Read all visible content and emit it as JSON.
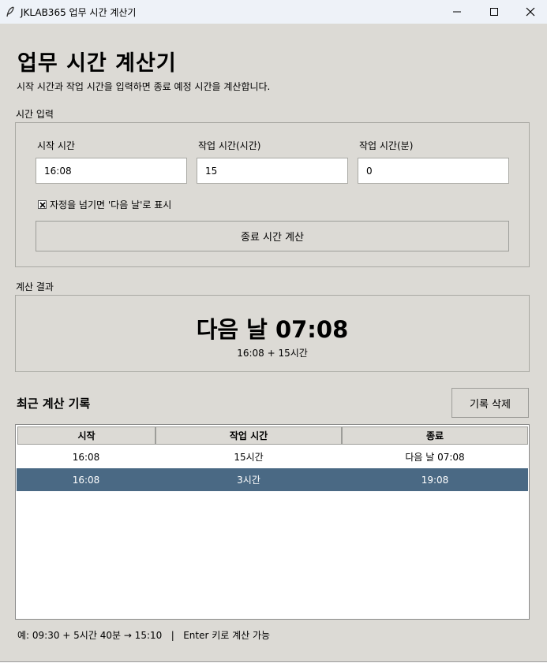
{
  "window": {
    "title": "JKLAB365 업무 시간 계산기",
    "icons": [
      "feather-icon",
      "minimize-icon",
      "maximize-icon",
      "close-icon"
    ]
  },
  "header": {
    "title": "업무 시간 계산기",
    "subtitle": "시작 시간과 작업 시간을 입력하면 종료 예정 시간을 계산합니다."
  },
  "input_section": {
    "label": "시간 입력",
    "start_label": "시작 시간",
    "start_value": "16:08",
    "hours_label": "작업 시간(시간)",
    "hours_value": "15",
    "minutes_label": "작업 시간(분)",
    "minutes_value": "0",
    "nextday_checkbox_label": "자정을 넘기면 '다음 날'로 표시",
    "nextday_checked": true,
    "calculate_button": "종료 시간 계산"
  },
  "result_section": {
    "label": "계산 결과",
    "end_time": "다음 날 07:08",
    "detail": "16:08 + 15시간"
  },
  "history": {
    "title": "최근 계산 기록",
    "clear_button": "기록 삭제",
    "columns": [
      "시작",
      "작업 시간",
      "종료"
    ],
    "rows": [
      {
        "start": "16:08",
        "duration": "15시간",
        "end": "다음 날 07:08",
        "selected": false
      },
      {
        "start": "16:08",
        "duration": "3시간",
        "end": "19:08",
        "selected": true
      }
    ]
  },
  "footer": {
    "hint": "예: 09:30 + 5시간 40분 → 15:10   |   Enter 키로 계산 가능"
  },
  "colors": {
    "window_bg": "#dcdad5",
    "selected_row": "#4a6984"
  }
}
